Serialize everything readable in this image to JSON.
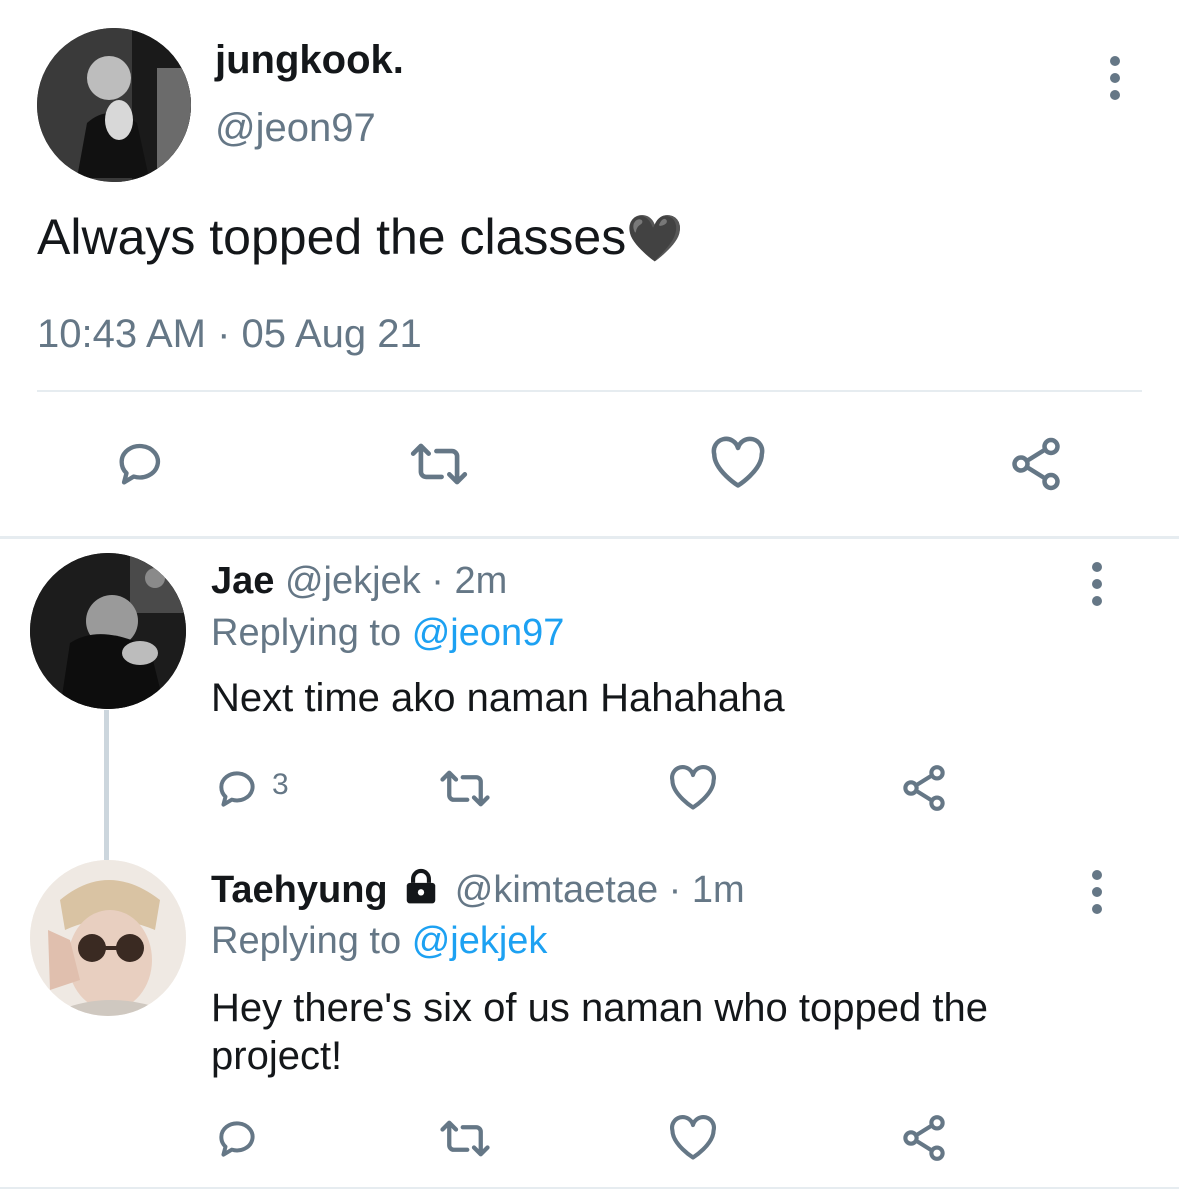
{
  "main_tweet": {
    "display_name": "jungkook.",
    "handle": "@jeon97",
    "text": "Always topped the classes",
    "emoji": "🖤",
    "timestamp": "10:43 AM · 05 Aug 21"
  },
  "replies": [
    {
      "display_name": "Jae",
      "handle": "@jekjek",
      "time": "· 2m",
      "replying_prefix": "Replying to",
      "replying_handle": "@jeon97",
      "text": "Next time ako naman Hahahaha",
      "reply_count": "3"
    },
    {
      "display_name": "Taehyung",
      "locked": true,
      "handle": "@kimtaetae",
      "time": "· 1m",
      "replying_prefix": "Replying to",
      "replying_handle": "@jekjek",
      "text": "Hey there's six of us naman who topped the project!"
    }
  ],
  "colors": {
    "text": "#14171a",
    "secondary": "#657786",
    "link": "#1da1f2",
    "divider": "#e6ecf0",
    "thread_line": "#ccd6dd"
  },
  "icons": [
    "comment-icon",
    "retweet-icon",
    "heart-icon",
    "share-icon",
    "more-icon",
    "lock-icon"
  ]
}
